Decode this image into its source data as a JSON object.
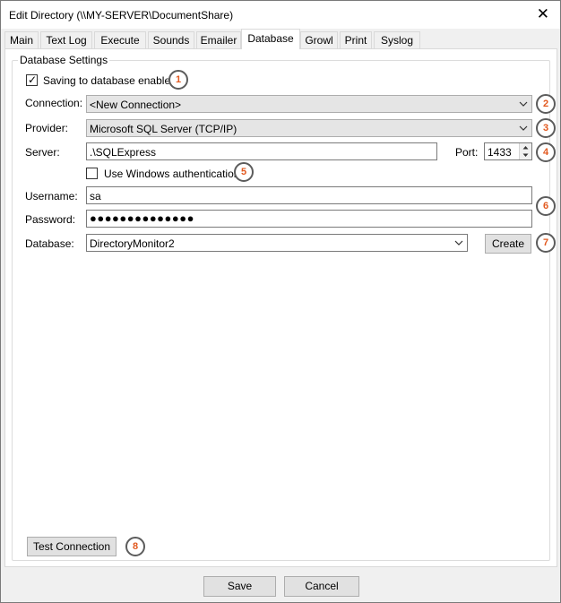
{
  "window": {
    "title": "Edit Directory (\\\\MY-SERVER\\DocumentShare)",
    "close_icon": "close-icon"
  },
  "tabs": [
    {
      "label": "Main",
      "active": false
    },
    {
      "label": "Text Log",
      "active": false
    },
    {
      "label": "Execute",
      "active": false
    },
    {
      "label": "Sounds",
      "active": false
    },
    {
      "label": "Emailer",
      "active": false
    },
    {
      "label": "Database",
      "active": true
    },
    {
      "label": "Growl",
      "active": false
    },
    {
      "label": "Print",
      "active": false
    },
    {
      "label": "Syslog",
      "active": false
    }
  ],
  "group": {
    "label": "Database Settings"
  },
  "saving": {
    "label": "Saving to database enabled",
    "checked": true
  },
  "connection": {
    "label": "Connection:",
    "value": "<New Connection>"
  },
  "provider": {
    "label": "Provider:",
    "value": "Microsoft SQL Server (TCP/IP)"
  },
  "server": {
    "label": "Server:",
    "value": ".\\SQLExpress"
  },
  "port": {
    "label": "Port:",
    "value": "1433"
  },
  "windows_auth": {
    "label": "Use Windows authentication",
    "checked": false
  },
  "username": {
    "label": "Username:",
    "value": "sa"
  },
  "password": {
    "label": "Password:",
    "masked": "●●●●●●●●●●●●●●"
  },
  "database": {
    "label": "Database:",
    "value": "DirectoryMonitor2",
    "create_label": "Create"
  },
  "test_connection_label": "Test Connection",
  "footer": {
    "save_label": "Save",
    "cancel_label": "Cancel"
  },
  "badges": [
    "1",
    "2",
    "3",
    "4",
    "5",
    "6",
    "7",
    "8"
  ],
  "colors": {
    "badge_text": "#e2591f",
    "badge_border": "#5c5c5c",
    "window_bg": "#f0f0f0"
  }
}
